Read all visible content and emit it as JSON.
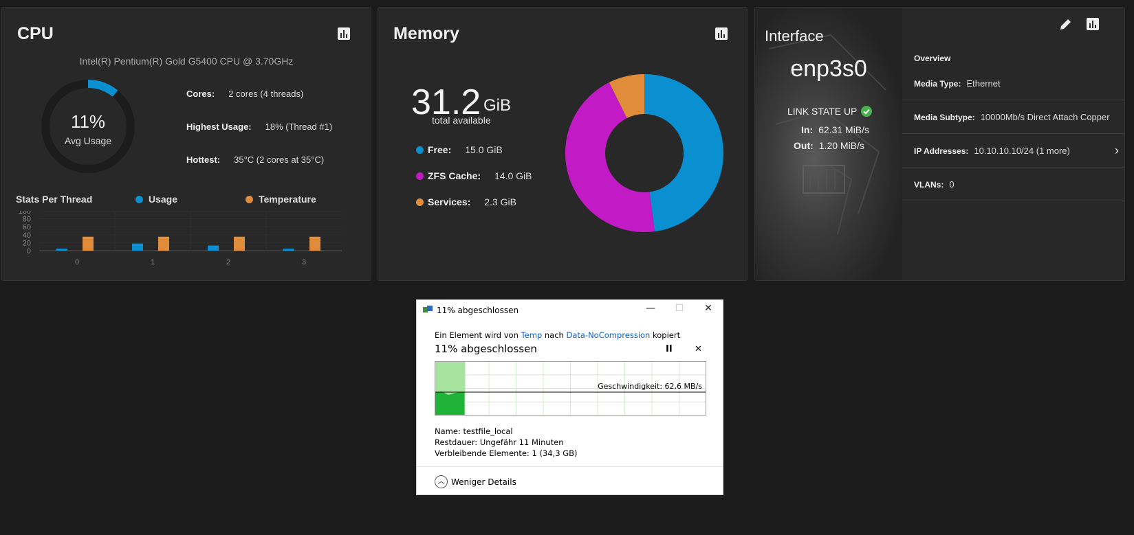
{
  "cpu": {
    "title": "CPU",
    "model": "Intel(R) Pentium(R) Gold G5400 CPU @ 3.70GHz",
    "avg_usage": "11%",
    "avg_usage_value": 11,
    "avg_usage_label": "Avg Usage",
    "cores_label": "Cores:",
    "cores_value": "2 cores  (4 threads)",
    "highest_label": "Highest Usage:",
    "highest_value": "18%  (Thread #1)",
    "hottest_label": "Hottest:",
    "hottest_value": "35°C  (2 cores at 35°C)",
    "stats_title": "Stats Per Thread",
    "legend_usage": "Usage",
    "legend_temp": "Temperature",
    "colors": {
      "usage": "#0a8fd1",
      "temperature": "#e08c3a",
      "gauge_track": "#1c1c1c"
    }
  },
  "chart_data": {
    "type": "bar",
    "categories": [
      "0",
      "1",
      "2",
      "3"
    ],
    "series": [
      {
        "name": "Usage",
        "values": [
          5,
          18,
          13,
          5
        ]
      },
      {
        "name": "Temperature",
        "values": [
          35,
          35,
          35,
          35
        ]
      }
    ],
    "y_ticks": [
      "0",
      "20",
      "40",
      "60",
      "80",
      "100"
    ],
    "ylim": [
      0,
      100
    ]
  },
  "memory": {
    "title": "Memory",
    "total_value": "31.2",
    "total_unit": "GiB",
    "total_label": "total available",
    "items": [
      {
        "label": "Free:",
        "value": "15.0 GiB",
        "amount": 15.0,
        "color": "#0a8fd1"
      },
      {
        "label": "ZFS Cache:",
        "value": "14.0 GiB",
        "amount": 14.0,
        "color": "#c21ac4"
      },
      {
        "label": "Services:",
        "value": "2.3 GiB",
        "amount": 2.3,
        "color": "#e08c3a"
      }
    ]
  },
  "interface": {
    "title": "Interface",
    "name": "enp3s0",
    "link_state": "LINK STATE UP",
    "in_label": "In:",
    "in_value": "62.31 MiB/s",
    "out_label": "Out:",
    "out_value": "1.20 MiB/s",
    "overview": "Overview",
    "media_type_label": "Media Type:",
    "media_type_value": "Ethernet",
    "media_subtype_label": "Media Subtype:",
    "media_subtype_value": "10000Mb/s Direct Attach Copper",
    "ip_label": "IP Addresses:",
    "ip_value": "10.10.10.10/24  (1 more)",
    "vlans_label": "VLANs:",
    "vlans_value": "0",
    "link_color": "#4caf50"
  },
  "dialog": {
    "title": "11% abgeschlossen",
    "line_prefix": "Ein Element wird von",
    "source": "Temp",
    "line_mid": "nach",
    "destination": "Data-NoCompression",
    "line_suffix": "kopiert",
    "progress_text": "11% abgeschlossen",
    "progress_value": 11,
    "pause_label": "II",
    "cancel_label": "✕",
    "speed_text": "Geschwindigkeit: 62,6 MB/s",
    "name_label": "Name:",
    "name_value": "testfile_local",
    "remaining_label": "Restdauer:",
    "remaining_value": "Ungefähr 11 Minuten",
    "items_label": "Verbleibende Elemente:",
    "items_value": "1 (34,3 GB)",
    "less_details": "Weniger Details",
    "minimize": "—",
    "maximize": "☐",
    "close": "✕"
  }
}
